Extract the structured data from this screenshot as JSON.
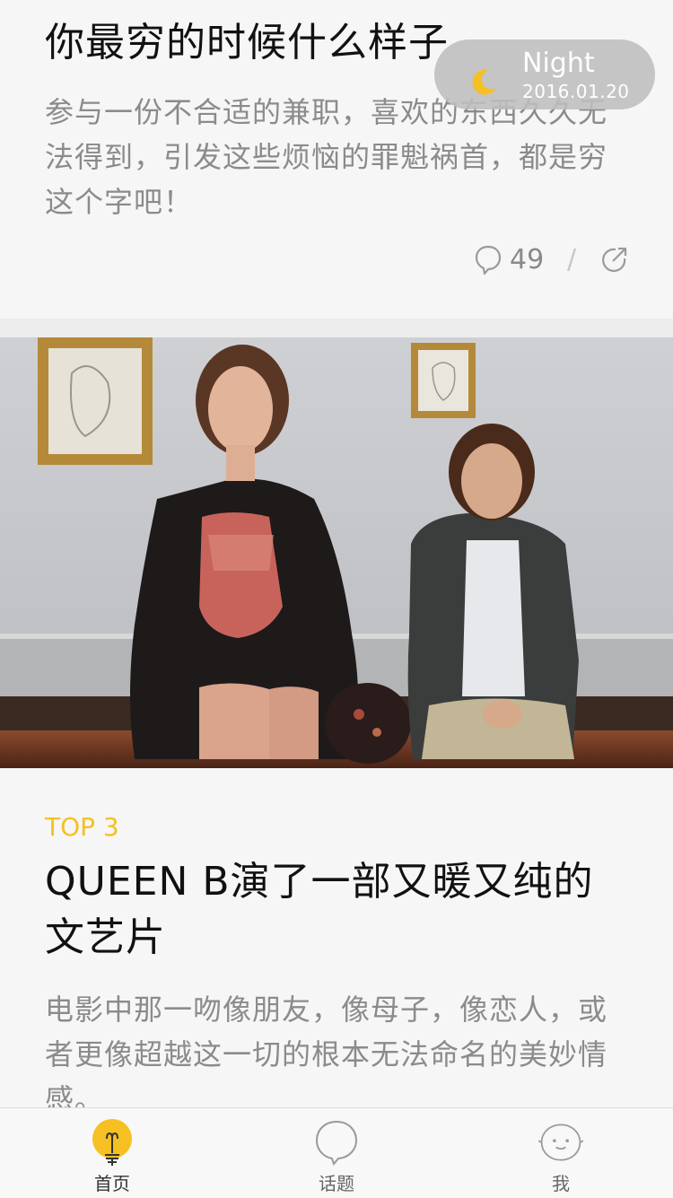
{
  "article1": {
    "title": "你最穷的时候什么样子",
    "excerpt": "参与一份不合适的兼职，喜欢的东西久久无法得到，引发这些烦恼的罪魁祸首，都是穷这个字吧！",
    "comment_count": "49",
    "separator": "/"
  },
  "night_mode": {
    "label": "Night",
    "date": "2016.01.20",
    "icon": "moon-icon"
  },
  "article2": {
    "rank": "TOP 3",
    "title": "QUEEN B演了一部又暖又纯的文艺片",
    "excerpt": "电影中那一吻像朋友，像母子，像恋人，或者更像超越这一切的根本无法命名的美妙情感。"
  },
  "tabbar": {
    "items": [
      {
        "label": "首页",
        "icon": "lightbulb-icon",
        "active": true
      },
      {
        "label": "话题",
        "icon": "speech-bubble-icon",
        "active": false
      },
      {
        "label": "我",
        "icon": "face-icon",
        "active": false
      }
    ]
  },
  "colors": {
    "accent": "#f6c022",
    "text_primary": "#111111",
    "text_secondary": "#8b8b8b"
  }
}
